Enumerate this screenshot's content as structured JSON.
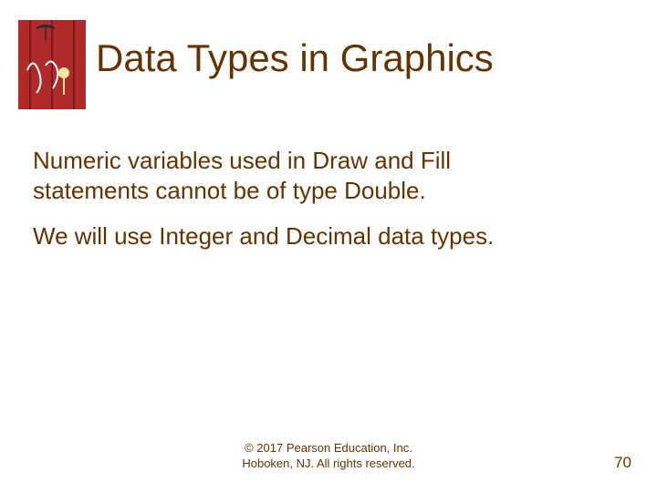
{
  "title": "Data Types in Graphics",
  "para1_line1": "Numeric variables used in Draw and Fill",
  "para1_line2": "statements cannot be of type Double.",
  "para2": "We will use Integer and Decimal data types.",
  "footer_line1": "© 2017 Pearson Education, Inc.",
  "footer_line2": "Hoboken, NJ. All rights reserved.",
  "page_number": "70"
}
